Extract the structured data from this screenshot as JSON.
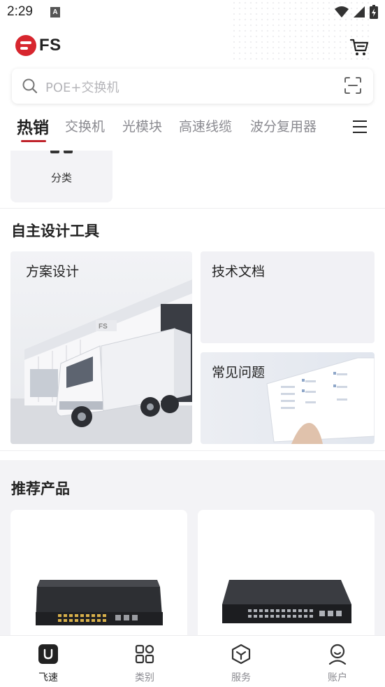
{
  "status_bar": {
    "time": "2:29",
    "notification_badge": "A"
  },
  "header": {
    "logo_text": "FS",
    "brand_color": "#d7262e"
  },
  "search": {
    "placeholder": "POE+交换机"
  },
  "tabs": [
    {
      "label": "热销",
      "active": true
    },
    {
      "label": "交换机",
      "active": false
    },
    {
      "label": "光模块",
      "active": false
    },
    {
      "label": "高速线缆",
      "active": false
    },
    {
      "label": "波分复用器",
      "active": false
    }
  ],
  "category_card": {
    "label": "分类"
  },
  "design_tools": {
    "title": "自主设计工具",
    "items": [
      {
        "label": "方案设计"
      },
      {
        "label": "技术文档"
      },
      {
        "label": "常见问题"
      }
    ]
  },
  "recommended": {
    "title": "推荐产品"
  },
  "bottom_nav": [
    {
      "label": "飞速",
      "icon": "feisu-home-icon",
      "active": true
    },
    {
      "label": "类别",
      "icon": "category-grid-icon",
      "active": false
    },
    {
      "label": "服务",
      "icon": "service-cube-icon",
      "active": false
    },
    {
      "label": "账户",
      "icon": "account-person-icon",
      "active": false
    }
  ],
  "colors": {
    "accent": "#c0242c",
    "muted_text": "#8a8a90",
    "card_bg": "#f3f3f6"
  }
}
